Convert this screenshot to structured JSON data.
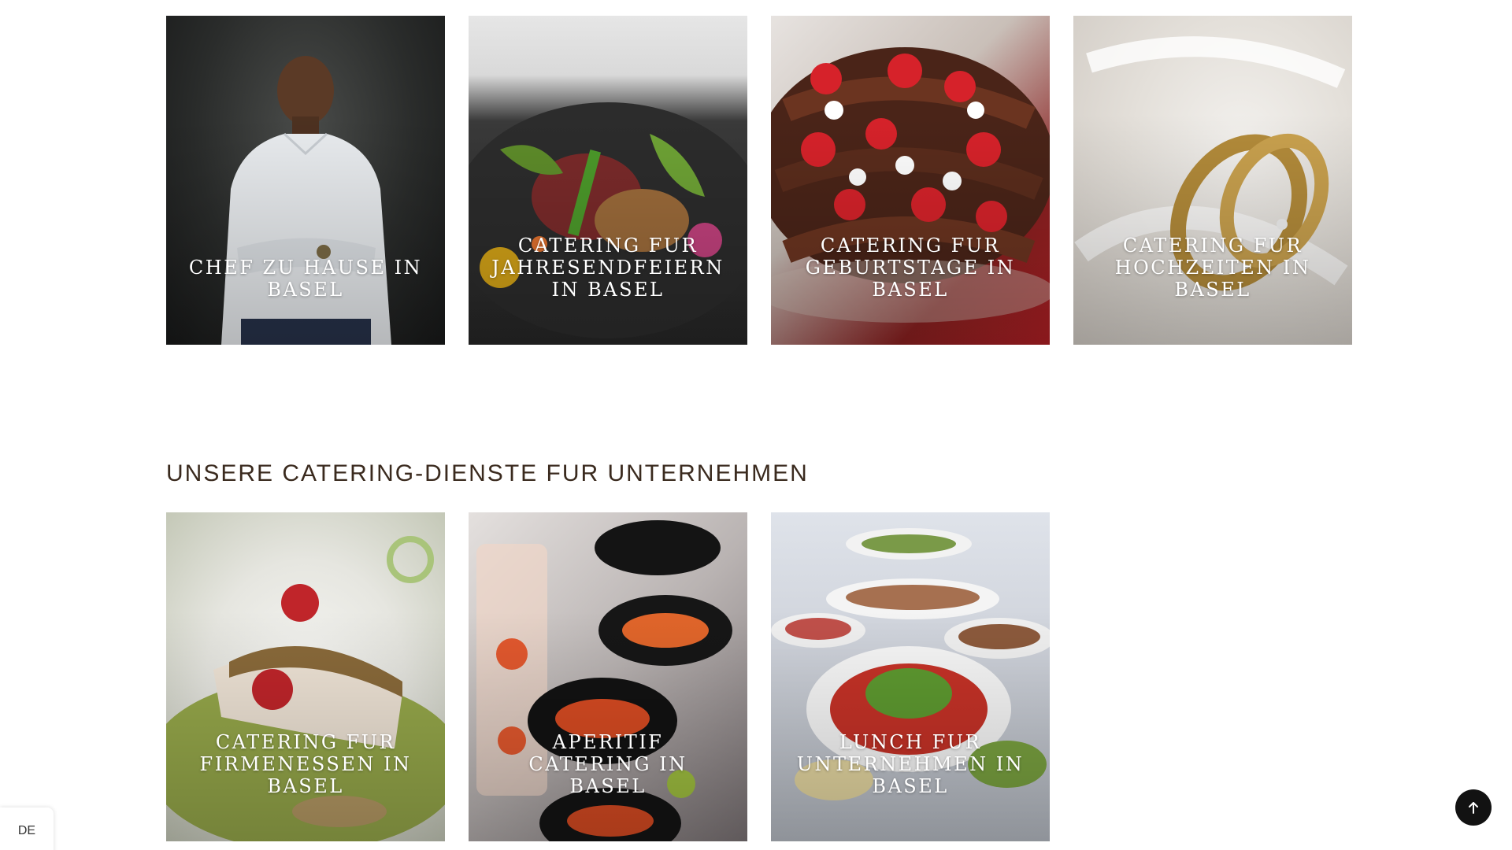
{
  "top_services": [
    {
      "title": "CHEF ZU HAUSE IN BASEL",
      "image": "chef-portrait"
    },
    {
      "title": "CATERING FUR JAHRESENDFEIERN IN BASEL",
      "image": "gourmet-dish"
    },
    {
      "title": "CATERING FUR GEBURTSTAGE IN BASEL",
      "image": "strawberry-chocolate-cake"
    },
    {
      "title": "CATERING FUR HOCHZEITEN IN BASEL",
      "image": "wedding-rings"
    }
  ],
  "corporate_section": {
    "heading": "UNSERE CATERING-DIENSTE FUR UNTERNEHMEN",
    "services": [
      {
        "title": "CATERING FUR FIRMENESSEN IN BASEL",
        "image": "fish-fillet-plate"
      },
      {
        "title": "APERITIF CATERING IN BASEL",
        "image": "caviar-appetizer-bowls"
      },
      {
        "title": "LUNCH FUR UNTERNEHMEN IN BASEL",
        "image": "buffet-salad-platters"
      }
    ]
  },
  "language_switcher": {
    "label": "DE"
  },
  "scroll_top": {
    "icon": "arrow-up-icon"
  },
  "colors": {
    "heading": "#3a2a1e",
    "card_text": "#ffffff",
    "scroll_button": "#121212"
  }
}
